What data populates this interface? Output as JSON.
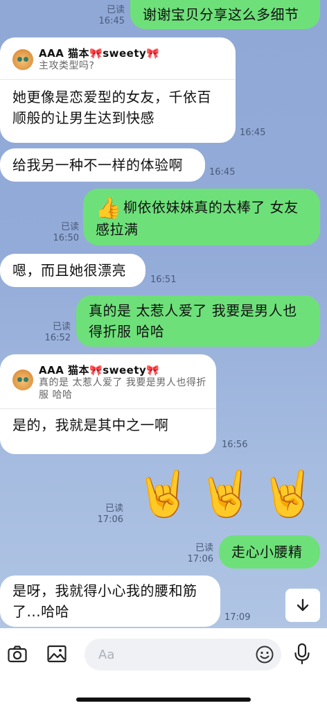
{
  "messages": {
    "m1": {
      "text": "谢谢宝贝分享这么多细节",
      "read": "已读",
      "time": "16:45"
    },
    "m2": {
      "reply_name": "AAA 猫本🎀sweety🎀",
      "reply_quote": "主攻类型吗?",
      "text": "她更像是恋爱型的女友，千依百顺般的让男生达到快感",
      "time": "16:45"
    },
    "m3": {
      "text": "给我另一种不一样的体验啊",
      "time": "16:45"
    },
    "m4": {
      "emoji": "👍",
      "text": "柳依依妹妹真的太棒了 女友感拉满",
      "read": "已读",
      "time": "16:50"
    },
    "m5": {
      "text": "嗯，而且她很漂亮",
      "time": "16:51"
    },
    "m6": {
      "text": "真的是 太惹人爱了 我要是男人也得折服 哈哈",
      "read": "已读",
      "time": "16:52"
    },
    "m7": {
      "reply_name": "AAA 猫本🎀sweety🎀",
      "reply_quote": "真的是 太惹人爱了 我要是男人也得折服 哈哈",
      "text": "是的，我就是其中之一啊",
      "time": "16:56"
    },
    "m8": {
      "emojis": [
        "🤘",
        "🤘",
        "🤘"
      ],
      "read": "已读",
      "time": "17:06"
    },
    "m9": {
      "text": "走心小腰精",
      "read": "已读",
      "time": "17:06"
    },
    "m10": {
      "text": "是呀，我就得小心我的腰和筋了...哈哈",
      "time": "17:09"
    }
  },
  "composer": {
    "placeholder": "Aa",
    "icons": [
      "camera-icon",
      "image-icon",
      "emoji-icon",
      "microphone-icon",
      "arrow-down-icon"
    ]
  },
  "colors": {
    "background": "#93abd8",
    "incoming_bubble": "#ffffff",
    "outgoing_bubble": "#6ee07a"
  }
}
